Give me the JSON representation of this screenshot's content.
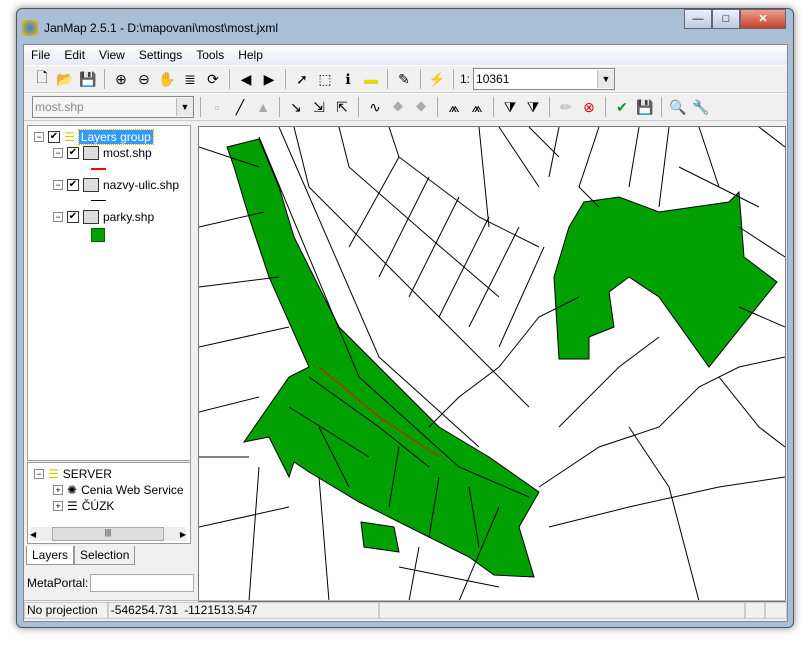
{
  "window": {
    "title": "JanMap 2.5.1  -  D:\\mapovani\\most\\most.jxml",
    "minimize": "—",
    "maximize": "□",
    "close": "✕"
  },
  "menu": [
    "File",
    "Edit",
    "View",
    "Settings",
    "Tools",
    "Help"
  ],
  "toolbar": {
    "scale_prefix": "1:",
    "scale_value": "10361",
    "layer_select": "most.shp"
  },
  "layers": {
    "group": "Layers group",
    "items": [
      {
        "name": "most.shp",
        "color": "#ff0000"
      },
      {
        "name": "nazvy-ulic.shp",
        "color": "#000000"
      },
      {
        "name": "parky.shp",
        "color": "#00a000"
      }
    ]
  },
  "server": {
    "root": "SERVER",
    "items": [
      "Cenia Web Service",
      "ČÚZK"
    ]
  },
  "tabs": [
    "Layers",
    "Selection"
  ],
  "metaportal": {
    "label": "MetaPortal:",
    "value": ""
  },
  "status": {
    "projection": "No projection",
    "x": "-546254.731",
    "y": "-1121513.547"
  },
  "colors": {
    "park": "#00a000",
    "selection": "#3399ff"
  }
}
